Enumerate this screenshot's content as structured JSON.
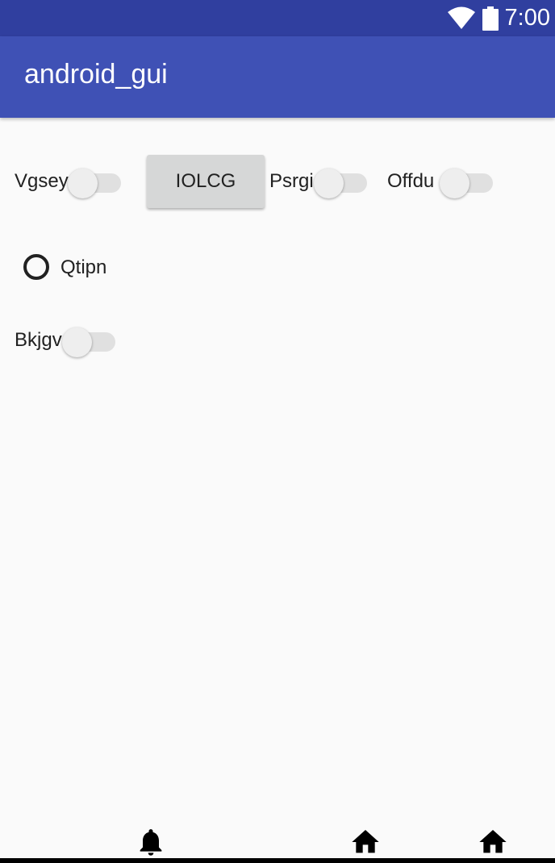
{
  "status_bar": {
    "time": "7:00",
    "icons": [
      "wifi-icon",
      "battery-icon"
    ],
    "color": "#303f9f"
  },
  "app_bar": {
    "title": "android_gui",
    "color": "#3f51b5"
  },
  "switches": [
    {
      "label": "Vgsey",
      "checked": false
    },
    {
      "label": "Psrgi",
      "checked": false
    },
    {
      "label": "Offdu",
      "checked": false
    },
    {
      "label": "Bkjgv",
      "checked": false
    }
  ],
  "button": {
    "label": "IOLCG"
  },
  "radio": {
    "label": "Qtipn",
    "checked": false
  },
  "bottom_icons": [
    "bell-icon",
    "home-icon",
    "home-icon"
  ]
}
